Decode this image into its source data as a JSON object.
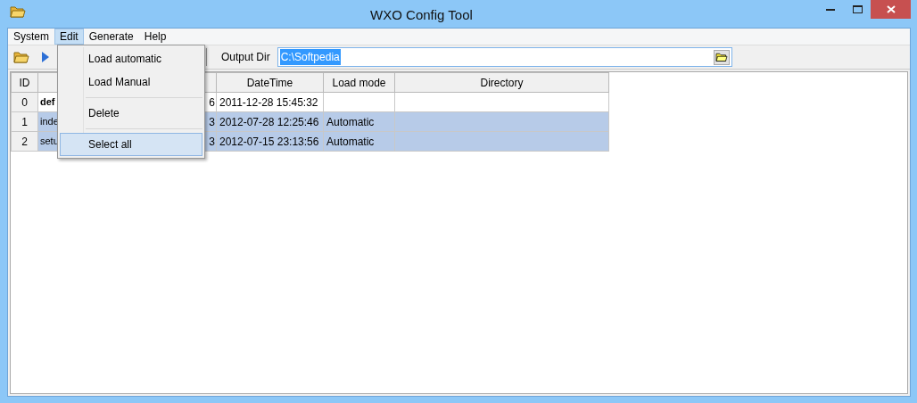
{
  "window": {
    "title": "WXO Config Tool"
  },
  "menu_bar": [
    {
      "label": "System",
      "selected": false
    },
    {
      "label": "Edit",
      "selected": true
    },
    {
      "label": "Generate",
      "selected": false
    },
    {
      "label": "Help",
      "selected": false
    }
  ],
  "edit_menu": [
    {
      "kind": "item",
      "label": "Load automatic",
      "highlighted": false
    },
    {
      "kind": "item",
      "label": "Load Manual",
      "highlighted": false
    },
    {
      "kind": "separator"
    },
    {
      "kind": "item",
      "label": "Delete",
      "highlighted": false
    },
    {
      "kind": "separator"
    },
    {
      "kind": "item",
      "label": "Select all",
      "highlighted": true
    }
  ],
  "toolbar": {
    "output_dir_label": "Output Dir",
    "output_dir": "C:\\Softpedia",
    "output_dir_text_selected": true
  },
  "table": {
    "columns": [
      {
        "label": "ID"
      },
      {},
      {},
      {
        "label": "DateTime"
      },
      {
        "label": "Load mode"
      },
      {
        "label": "Directory"
      }
    ],
    "rows": [
      {
        "cells": [
          "0",
          "def",
          "6",
          "2011-12-28 15:45:32",
          null,
          null
        ],
        "bold": true,
        "selected": false
      },
      {
        "cells": [
          "1",
          "inde",
          "3",
          "2012-07-28 12:25:46",
          "Automatic",
          null
        ],
        "bold": false,
        "selected": true
      },
      {
        "cells": [
          "2",
          "setu",
          "3",
          "2012-07-15 23:13:56",
          "Automatic",
          null
        ],
        "bold": false,
        "selected": true
      }
    ]
  }
}
